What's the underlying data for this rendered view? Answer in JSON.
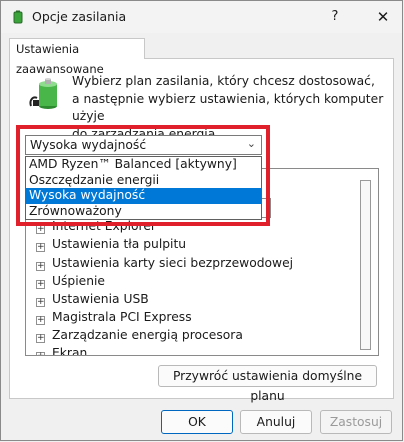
{
  "window": {
    "title": "Opcje zasilania",
    "help_glyph": "?",
    "close_glyph": "✕"
  },
  "tab": {
    "label": "Ustawienia zaawansowane"
  },
  "description": {
    "line1": "Wybierz plan zasilania, który chcesz dostosować,",
    "line2": "a następnie wybierz ustawienia, których komputer użyje",
    "line3": "do zarządzania energią."
  },
  "plan_select": {
    "value": "Wysoka wydajność",
    "chevron": "⌄",
    "options": [
      "AMD Ryzen™ Balanced [aktywny]",
      "Oszczędzanie energii",
      "Wysoka wydajność",
      "Zrównoważony"
    ],
    "selected_option": "Wysoka wydajność"
  },
  "tree": {
    "expander_glyph": "+",
    "items": [
      "Internet Explorer",
      "Ustawienia tła pulpitu",
      "Ustawienia karty sieci bezprzewodowej",
      "Uśpienie",
      "Ustawienia USB",
      "Magistrala PCI Express",
      "Zarządzanie energią procesora",
      "Ekran"
    ]
  },
  "buttons": {
    "restore": "Przywróć ustawienia domyślne planu",
    "ok": "OK",
    "cancel": "Anuluj",
    "apply": "Zastosuj"
  },
  "colors": {
    "highlight": "#e0202a",
    "selection": "#0078d7"
  }
}
